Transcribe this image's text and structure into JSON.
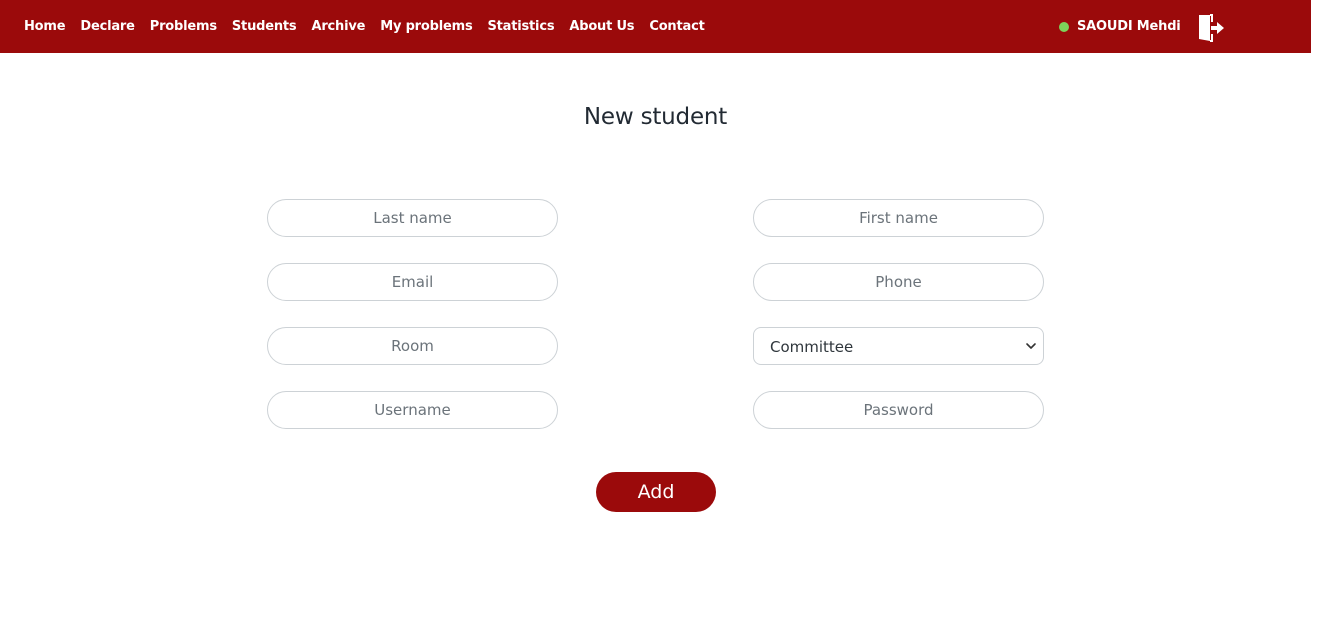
{
  "nav": {
    "links": [
      "Home",
      "Declare",
      "Problems",
      "Students",
      "Archive",
      "My problems",
      "Statistics",
      "About Us",
      "Contact"
    ],
    "user_name": "SAOUDI Mehdi",
    "status_icon": "online-status-dot",
    "logout_icon": "logout-icon"
  },
  "page": {
    "title": "New student"
  },
  "form": {
    "last_name_placeholder": "Last name",
    "first_name_placeholder": "First name",
    "email_placeholder": "Email",
    "phone_placeholder": "Phone",
    "room_placeholder": "Room",
    "committee_value": "Committee",
    "username_placeholder": "Username",
    "password_placeholder": "Password",
    "submit_label": "Add"
  },
  "colors": {
    "brand": "#9b0a0b",
    "status_online": "#7dd35a"
  }
}
